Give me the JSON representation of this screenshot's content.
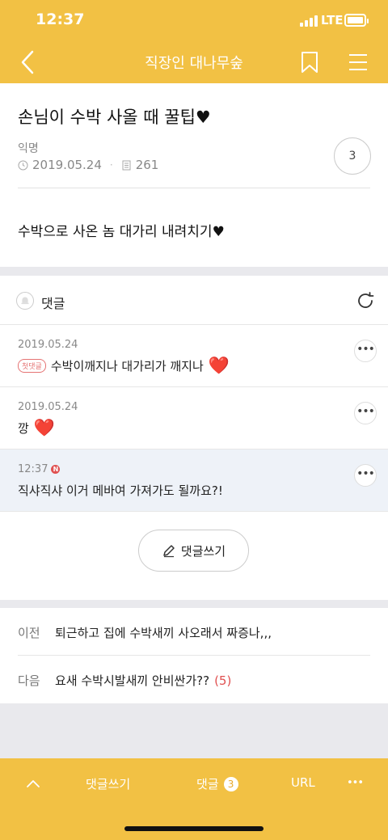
{
  "status": {
    "time": "12:37",
    "network": "LTE"
  },
  "nav": {
    "title": "직장인 대나무숲"
  },
  "post": {
    "title": "손님이 수박 사올 때 꿀팁♥",
    "author": "익명",
    "date": "2019.05.24",
    "views": "261",
    "comment_count": "3",
    "body": "수박으로 사온 놈 대가리 내려치기♥"
  },
  "comments": {
    "header": "댓글",
    "items": [
      {
        "date": "2019.05.24",
        "badge": "첫댓글",
        "text": "수박이깨지나 대가리가 깨지나",
        "emoji": "❤️"
      },
      {
        "date": "2019.05.24",
        "text": "깡",
        "emoji": "❤️"
      },
      {
        "date": "12:37",
        "new_badge": "N",
        "text": "직샤직샤 이거 메바여 가져가도 될까요?!"
      }
    ],
    "write_label": "댓글쓰기"
  },
  "adjacent": {
    "prev": {
      "label": "이전",
      "title": "퇴근하고 집에 수박새끼 사오래서 짜증나,,,"
    },
    "next": {
      "label": "다음",
      "title": "요새 수박시발새끼 안비싼가??",
      "count": "(5)"
    }
  },
  "bottom": {
    "write": "댓글쓰기",
    "comments": "댓글",
    "comments_count": "3",
    "url": "URL",
    "more": "•••"
  },
  "colors": {
    "accent": "#f2c144",
    "new_bg": "#eef2f8",
    "heart": "#e53935"
  }
}
